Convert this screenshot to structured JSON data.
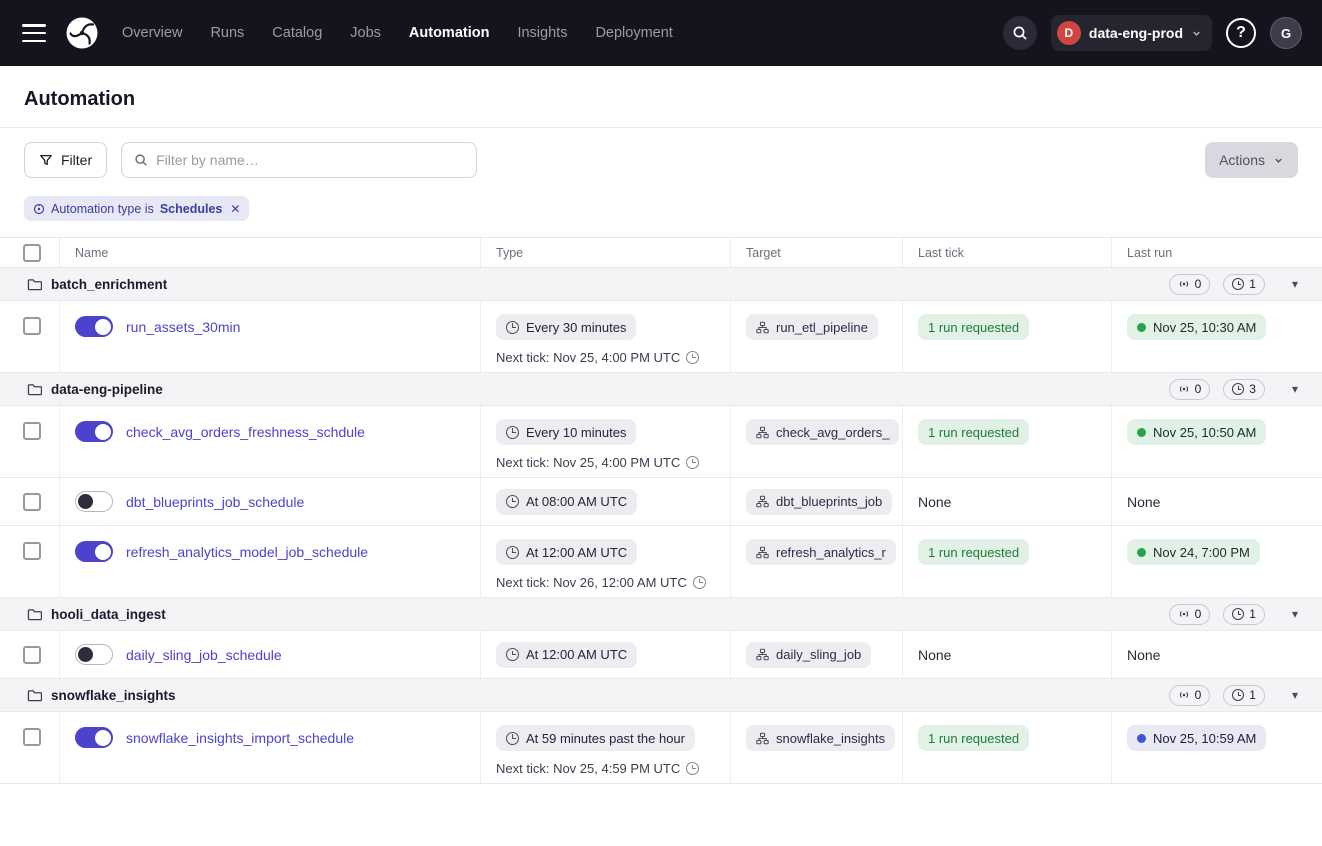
{
  "nav": {
    "items": [
      {
        "label": "Overview"
      },
      {
        "label": "Runs"
      },
      {
        "label": "Catalog"
      },
      {
        "label": "Jobs"
      },
      {
        "label": "Automation"
      },
      {
        "label": "Insights"
      },
      {
        "label": "Deployment"
      }
    ],
    "active_item": "Automation",
    "deployment": {
      "initial": "D",
      "name": "data-eng-prod"
    },
    "help_label": "?",
    "user_initial": "G"
  },
  "page": {
    "title": "Automation"
  },
  "toolbar": {
    "filter_label": "Filter",
    "search_placeholder": "Filter by name…",
    "actions_label": "Actions"
  },
  "filter_chip": {
    "prefix": "Automation type is",
    "value": "Schedules",
    "close_glyph": "✕"
  },
  "table": {
    "headers": {
      "name": "Name",
      "type": "Type",
      "target": "Target",
      "last_tick": "Last tick",
      "last_run": "Last run"
    },
    "caret_glyph": "▾",
    "groups": [
      {
        "name": "batch_enrichment",
        "sensor_count": "0",
        "schedule_count": "1",
        "rows": [
          {
            "name": "run_assets_30min",
            "enabled": true,
            "schedule": "Every 30 minutes",
            "next_tick": "Next tick: Nov 25, 4:00 PM UTC",
            "target": "run_etl_pipeline",
            "last_tick": "1 run requested",
            "last_run": "Nov 25, 10:30 AM",
            "last_run_status": "success"
          }
        ]
      },
      {
        "name": "data-eng-pipeline",
        "sensor_count": "0",
        "schedule_count": "3",
        "rows": [
          {
            "name": "check_avg_orders_freshness_schdule",
            "enabled": true,
            "schedule": "Every 10 minutes",
            "next_tick": "Next tick: Nov 25, 4:00 PM UTC",
            "target": "check_avg_orders_",
            "last_tick": "1 run requested",
            "last_run": "Nov 25, 10:50 AM",
            "last_run_status": "success"
          },
          {
            "name": "dbt_blueprints_job_schedule",
            "enabled": false,
            "schedule": "At 08:00 AM UTC",
            "target": "dbt_blueprints_job",
            "last_tick": "None",
            "last_run": "None"
          },
          {
            "name": "refresh_analytics_model_job_schedule",
            "enabled": true,
            "schedule": "At 12:00 AM UTC",
            "next_tick": "Next tick: Nov 26, 12:00 AM UTC",
            "target": "refresh_analytics_r",
            "last_tick": "1 run requested",
            "last_run": "Nov 24, 7:00 PM",
            "last_run_status": "success"
          }
        ]
      },
      {
        "name": "hooli_data_ingest",
        "sensor_count": "0",
        "schedule_count": "1",
        "rows": [
          {
            "name": "daily_sling_job_schedule",
            "enabled": false,
            "schedule": "At 12:00 AM UTC",
            "target": "daily_sling_job",
            "last_tick": "None",
            "last_run": "None"
          }
        ]
      },
      {
        "name": "snowflake_insights",
        "sensor_count": "0",
        "schedule_count": "1",
        "rows": [
          {
            "name": "snowflake_insights_import_schedule",
            "enabled": true,
            "schedule": "At 59 minutes past the hour",
            "next_tick": "Next tick: Nov 25, 4:59 PM UTC",
            "target": "snowflake_insights",
            "last_tick": "1 run requested",
            "last_run": "Nov 25, 10:59 AM",
            "last_run_status": "started"
          }
        ]
      }
    ]
  },
  "colors": {
    "nav_bg": "#14141e",
    "accent_blurple": "#4c43cd",
    "success_green": "#2aa34d",
    "started_blue": "#4053d8",
    "chip_grey": "#ececf1",
    "chip_green": "#e2f1e5",
    "filter_chip_bg": "#e7e7f6",
    "deploy_avatar_red": "#cf4641"
  }
}
